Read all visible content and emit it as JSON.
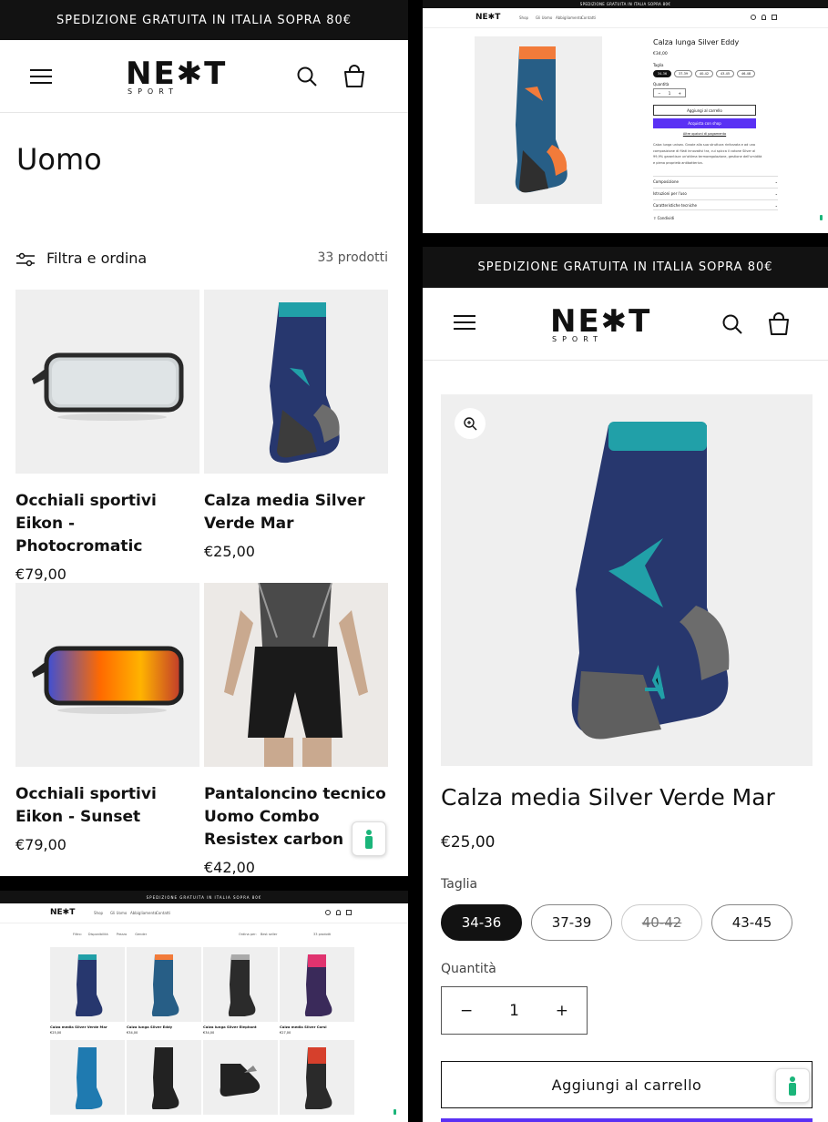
{
  "announcement": "SPEDIZIONE GRATUITA IN ITALIA SOPRA 80€",
  "brand": {
    "logo_main": "NE✱T",
    "logo_sub": "SPORT"
  },
  "nav": {
    "shop": "Shop",
    "uomo": "Gli Uomo",
    "abbigliamento": "Abbigliamento",
    "contatti": "Contatti"
  },
  "collection": {
    "title": "Uomo",
    "filter_label": "Filtra e ordina",
    "count": "33 prodotti",
    "products": [
      {
        "name": "Occhiali sportivi Eikon - Photocromatic",
        "price": "€79,00"
      },
      {
        "name": "Calza media Silver Verde Mar",
        "price": "€25,00"
      },
      {
        "name": "Occhiali sportivi Eikon - Sunset",
        "price": "€79,00"
      },
      {
        "name": "Pantaloncino tecnico Uomo Combo Resistex carbon",
        "price": "€42,00"
      }
    ]
  },
  "mini_product": {
    "title": "Calza lunga Silver Eddy",
    "price": "€34,00",
    "size_label": "Taglia",
    "sizes": [
      "34-36",
      "37-39",
      "40-42",
      "43-45",
      "46-48"
    ],
    "qty_label": "Quantità",
    "qty": "1",
    "add_to_cart": "Aggiungi al carrello",
    "buy_now": "Acquista con shop",
    "more_payment": "Altre opzioni di pagamento",
    "description": "Calza lunga unisex. Grazie alla sua struttura rinforzata e ad una composizione di filati innovativi tra, cui spicca il cotone Silver al 99,9% garantisce un'ottima termoregolazione, gestione dell'umidità e piena proprietà antibatterica.",
    "accordions": [
      "Composizione",
      "Istruzioni per l'uso",
      "Caratteristiche tecniche"
    ],
    "share": "Condividi"
  },
  "grid_page": {
    "filters": {
      "filter": "Filtro:",
      "availability": "Disponibilità",
      "price": "Prezzo",
      "gender": "Gender",
      "sort_label": "Ordina per:",
      "sort_value": "Best seller",
      "count": "33 prodotti"
    },
    "products": [
      {
        "name": "Calza media Silver Verde Mar",
        "price": "€25,00"
      },
      {
        "name": "Calza lunga Silver Eddy",
        "price": "€34,00"
      },
      {
        "name": "Calza lunga Silver Elephant",
        "price": "€34,00"
      },
      {
        "name": "Calza media Silver Corsi",
        "price": "€27,00"
      }
    ]
  },
  "product": {
    "title": "Calza media Silver Verde Mar",
    "price": "€25,00",
    "size_label": "Taglia",
    "sizes": [
      "34-36",
      "37-39",
      "40-42",
      "43-45"
    ],
    "qty_label": "Quantità",
    "qty": "1",
    "add_to_cart": "Aggiungi al carrello"
  },
  "colors": {
    "dark": "#121212",
    "accent": "#5a31f4",
    "teal": "#1e9aa4",
    "navy": "#26356c",
    "badge_green": "#1bb57a"
  }
}
